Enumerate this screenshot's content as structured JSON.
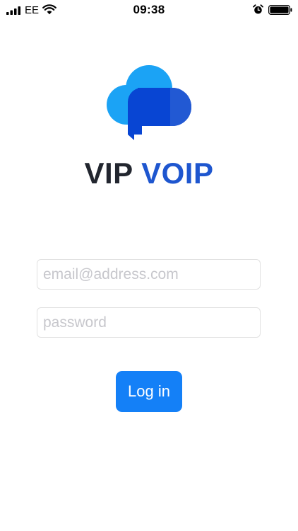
{
  "status_bar": {
    "carrier": "EE",
    "time": "09:38",
    "icons": [
      "signal-bars-icon",
      "wifi-icon",
      "alarm-clock-icon",
      "battery-icon"
    ],
    "battery_level": 1.0
  },
  "brand": {
    "logo_icon": "cloud-chat-bubble-icon",
    "name_part1": "VIP",
    "name_part2": "VOIP",
    "colors": {
      "dark": "#22262f",
      "blue": "#1e56cf",
      "light_blue": "#1ba3f5",
      "bubble": "#0845d3"
    }
  },
  "login_form": {
    "email_placeholder": "email@address.com",
    "email_value": "",
    "password_placeholder": "password",
    "password_value": "",
    "submit_label": "Log in",
    "accent_color": "#1480f7"
  }
}
